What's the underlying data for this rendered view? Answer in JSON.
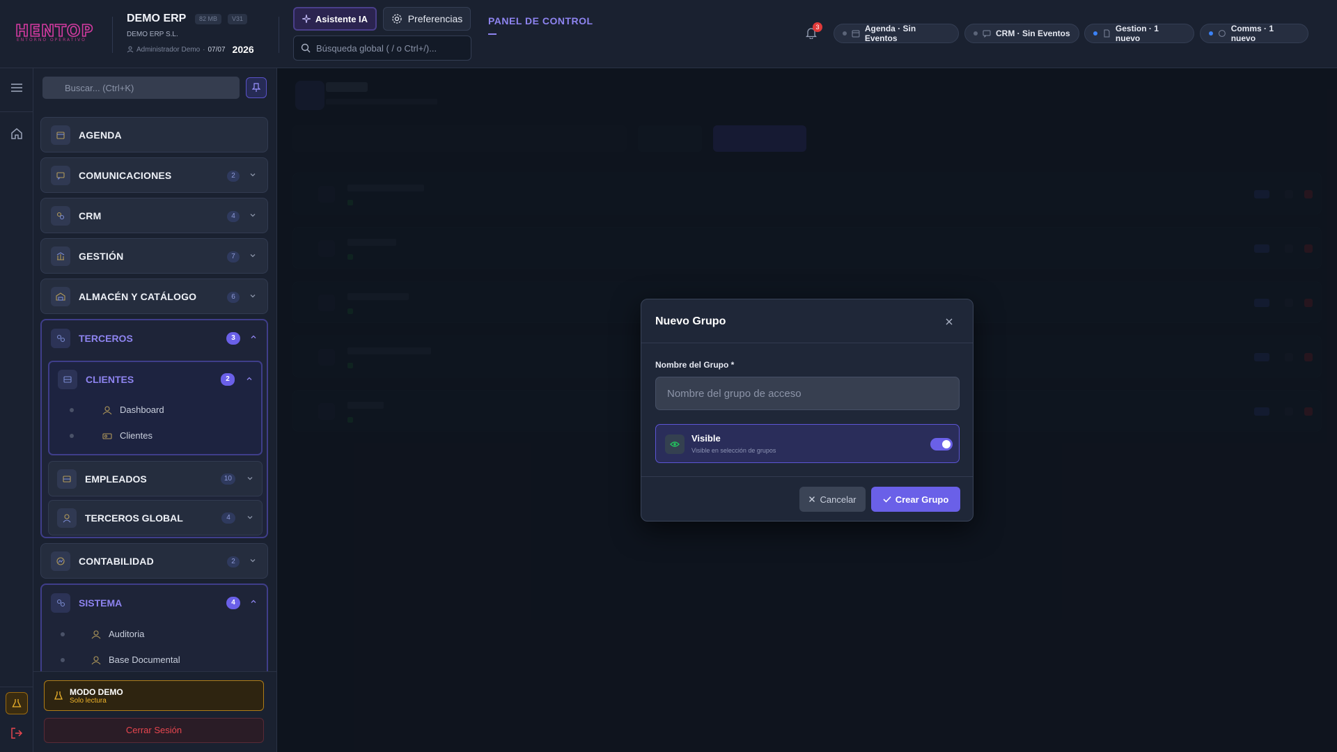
{
  "header": {
    "logo_text": "HENTOP",
    "logo_sub": "ENTORNO OPERATIVO",
    "app_title": "DEMO ERP",
    "mem_badge": "82 MB",
    "version_badge": "V31",
    "company": "DEMO ERP S.L.",
    "user": "Administrador Demo",
    "date": "07/07",
    "year": "2026",
    "ai_button": "Asistente IA",
    "prefs_button": "Preferencias",
    "search_placeholder": "Búsqueda global ( / o Ctrl+/)...",
    "panel_title": "PANEL DE CONTROL",
    "panel_dash": "—",
    "notif_count": "3",
    "chips": [
      {
        "label": "Agenda · Sin Eventos",
        "dot": "#5b6478"
      },
      {
        "label": "CRM · Sin Eventos",
        "dot": "#5b6478"
      },
      {
        "label": "Gestion · 1 nuevo",
        "dot": "#3b82f6"
      },
      {
        "label": "Comms · 1 nuevo",
        "dot": "#3b82f6"
      }
    ]
  },
  "sidebar": {
    "search_placeholder": "Buscar... (Ctrl+K)",
    "items": [
      {
        "label": "AGENDA",
        "count": ""
      },
      {
        "label": "COMUNICACIONES",
        "count": "2"
      },
      {
        "label": "CRM",
        "count": "4"
      },
      {
        "label": "GESTIÓN",
        "count": "7"
      },
      {
        "label": "ALMACÉN Y CATÁLOGO",
        "count": "6"
      }
    ],
    "terceros": {
      "label": "TERCEROS",
      "count": "3",
      "clientes": {
        "label": "CLIENTES",
        "count": "2",
        "children": [
          "Dashboard",
          "Clientes"
        ]
      },
      "empleados": {
        "label": "EMPLEADOS",
        "count": "10"
      },
      "terceros_global": {
        "label": "TERCEROS GLOBAL",
        "count": "4"
      }
    },
    "contabilidad": {
      "label": "CONTABILIDAD",
      "count": "2"
    },
    "sistema": {
      "label": "SISTEMA",
      "count": "4",
      "children": [
        "Auditoria",
        "Base Documental"
      ]
    },
    "demo_title": "MODO DEMO",
    "demo_sub": "Solo lectura",
    "logout": "Cerrar Sesión"
  },
  "modal": {
    "title": "Nuevo Grupo",
    "field_label": "Nombre del Grupo *",
    "field_placeholder": "Nombre del grupo de acceso",
    "visible_title": "Visible",
    "visible_sub": "Visible en selección de grupos",
    "visible_on": true,
    "cancel": "Cancelar",
    "create": "Crear Grupo"
  },
  "colors": {
    "accent": "#6a60e8",
    "accent_text": "#8e84f0",
    "danger": "#e8464f",
    "warning": "#f0b52b",
    "logo": "#d23aa0"
  }
}
